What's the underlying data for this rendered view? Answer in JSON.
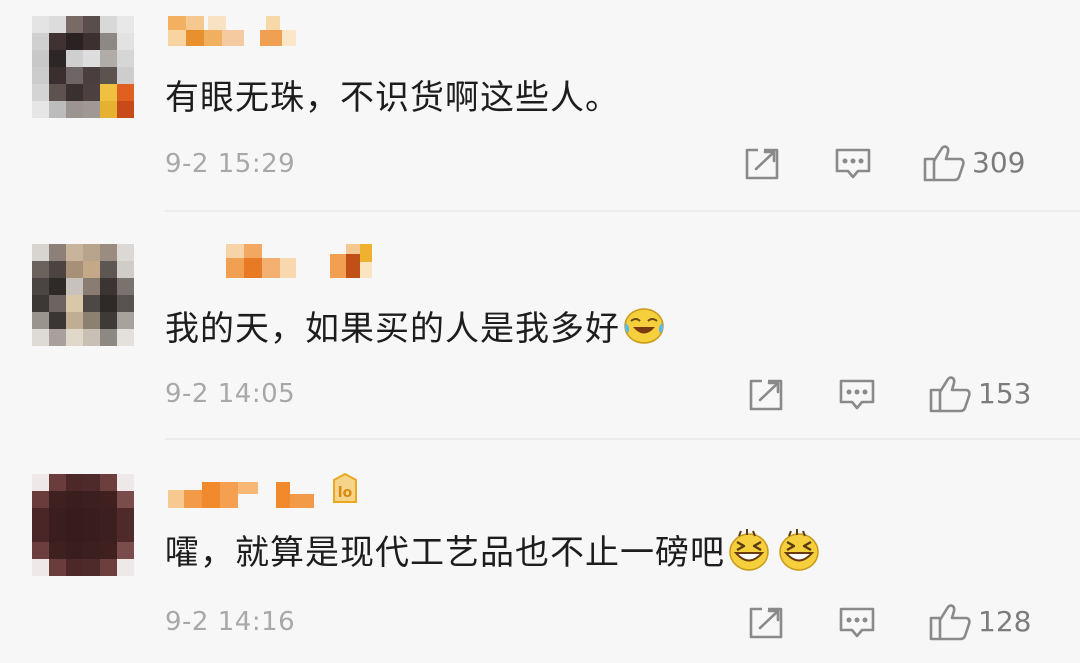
{
  "comments": [
    {
      "text": "有眼无珠，不识货啊这些人。",
      "time": "9-2 15:29",
      "likes": "309"
    },
    {
      "text": "我的天，如果买的人是我多好",
      "time": "9-2 14:05",
      "likes": "153",
      "emoji": "crying-laughing-emoji"
    },
    {
      "text": "嚯，就算是现代工艺品也不止一磅吧",
      "time": "9-2 14:16",
      "likes": "128",
      "emoji": "grinning-squint-emoji"
    }
  ],
  "icons": {
    "share": "share-icon",
    "reply": "comment-icon",
    "like": "thumbs-up-icon"
  },
  "colors": {
    "background": "#f7f7f7",
    "text": "#1d1d1d",
    "meta": "#a8a8a8",
    "icon": "#8a8a8a",
    "username_orange": "#f08a2c"
  }
}
